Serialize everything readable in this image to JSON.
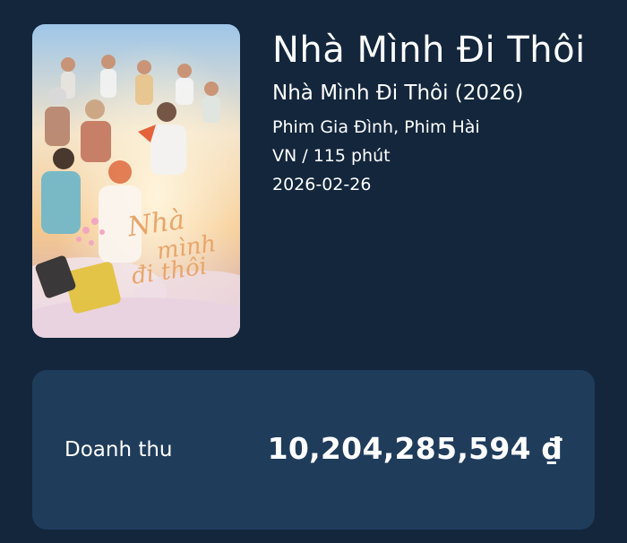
{
  "movie": {
    "title": "Nhà Mình Đi Thôi",
    "subtitle": "Nhà Mình Đi Thôi (2026)",
    "genres": "Phim Gia Đình, Phim Hài",
    "country_duration": "VN / 115 phút",
    "release_date": "2026-02-26",
    "poster_logo_text": "Nhà mình đi thôi"
  },
  "revenue": {
    "label": "Doanh thu",
    "value": "10,204,285,594 ₫"
  },
  "colors": {
    "background": "#13263c",
    "card": "#1f3c5b",
    "text": "#ffffff",
    "poster_logo": "#e8a56a"
  }
}
